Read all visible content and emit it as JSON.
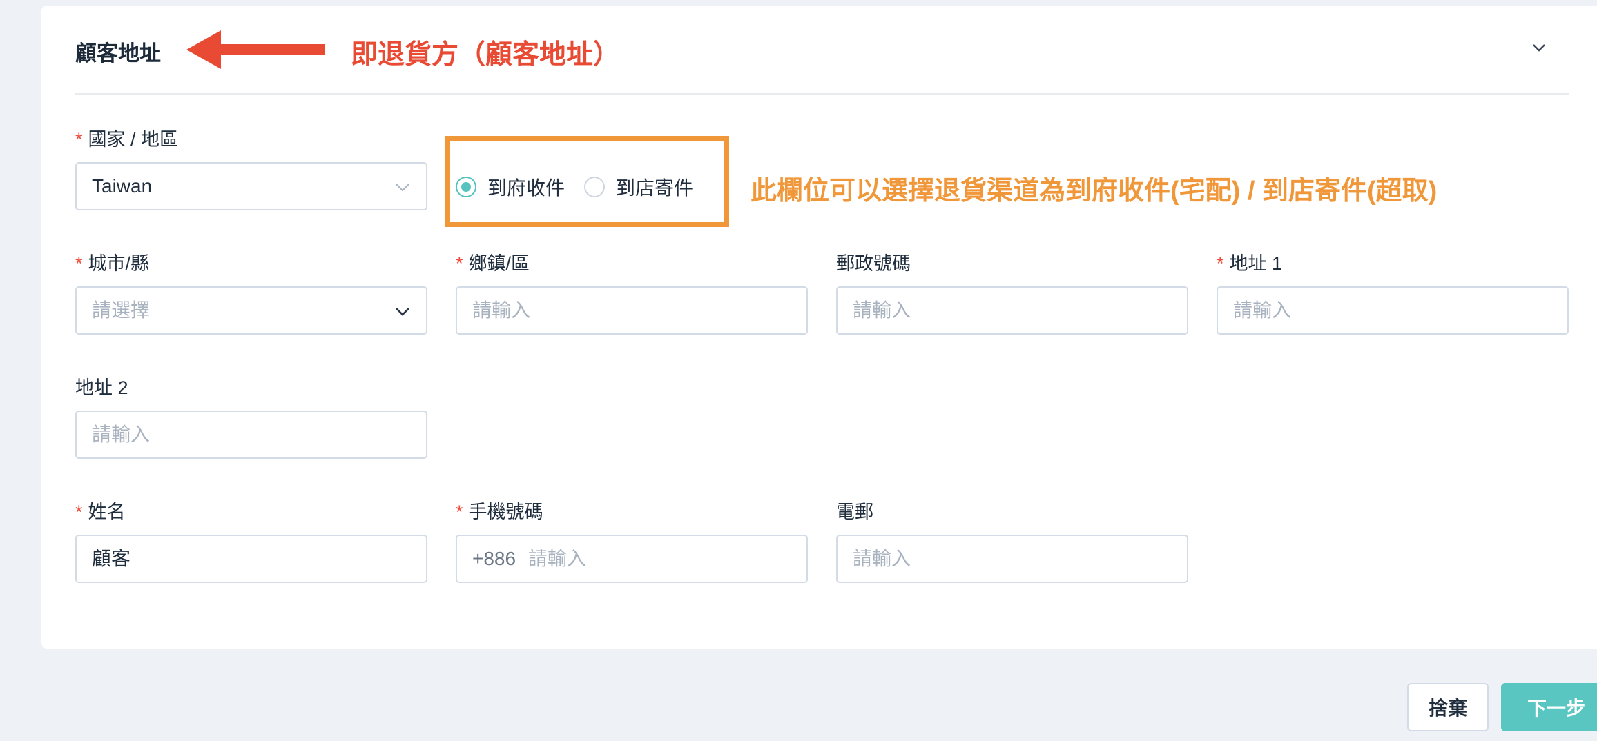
{
  "section": {
    "title": "顧客地址"
  },
  "annotations": {
    "red_note": "即退貨方（顧客地址）",
    "orange_note": "此欄位可以選擇退貨渠道為到府收件(宅配) / 到店寄件(超取)"
  },
  "colors": {
    "accent": "#5ac6c2",
    "required": "#f04a3a",
    "annotation_red": "#e84a33",
    "annotation_orange": "#f0973a"
  },
  "form": {
    "country": {
      "label": "國家 / 地區",
      "value": "Taiwan"
    },
    "pickup": {
      "options": [
        {
          "label": "到府收件",
          "selected": true
        },
        {
          "label": "到店寄件",
          "selected": false
        }
      ]
    },
    "city": {
      "label": "城市/縣",
      "placeholder": "請選擇"
    },
    "district": {
      "label": "鄉鎮/區",
      "placeholder": "請輸入"
    },
    "postal": {
      "label": "郵政號碼",
      "placeholder": "請輸入"
    },
    "address1": {
      "label": "地址 1",
      "placeholder": "請輸入"
    },
    "address2": {
      "label": "地址 2",
      "placeholder": "請輸入"
    },
    "name": {
      "label": "姓名",
      "value": "顧客"
    },
    "mobile": {
      "label": "手機號碼",
      "prefix": "+886",
      "placeholder": "請輸入"
    },
    "email": {
      "label": "電郵",
      "placeholder": "請輸入"
    },
    "required_mark": "*"
  },
  "actions": {
    "discard": "捨棄",
    "next": "下一步"
  },
  "icons": {
    "collapse": "chevron-down-icon",
    "select": "chevron-down-icon"
  }
}
